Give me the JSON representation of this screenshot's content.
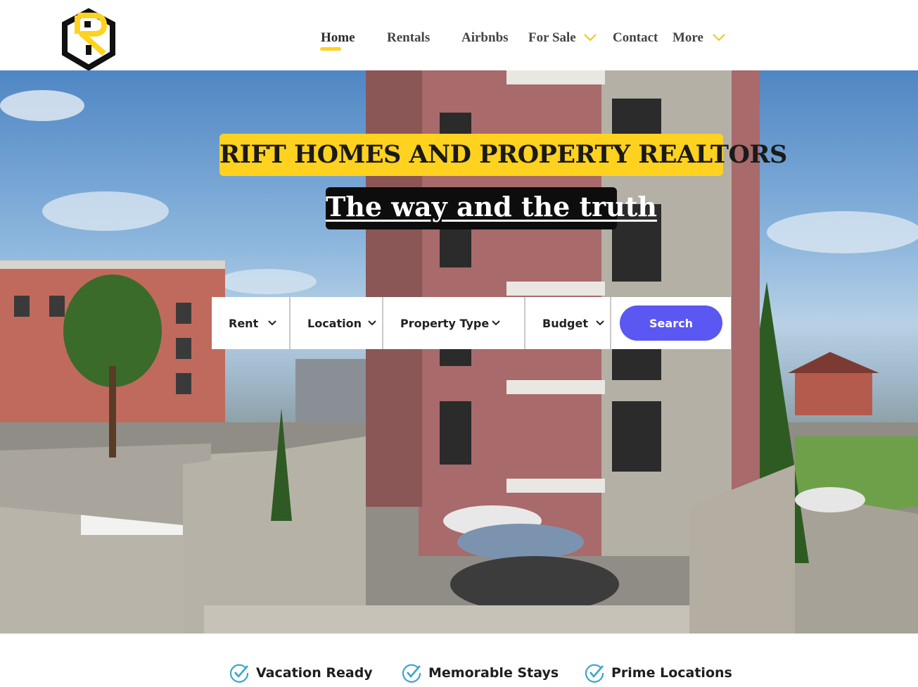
{
  "header": {
    "logo_icon": "rh-house-logo-icon",
    "nav": [
      {
        "label": "Home",
        "active": true
      },
      {
        "label": "Rentals"
      },
      {
        "label": "Airbnbs"
      },
      {
        "label": "For Sale",
        "has_dropdown": true
      },
      {
        "label": "Contact"
      },
      {
        "label": "More",
        "has_dropdown": true
      }
    ],
    "accent_color": "#ffd21f"
  },
  "hero": {
    "title": "RIFT HOMES AND PROPERTY REALTORS",
    "tagline": "The way and the truth",
    "search": {
      "fields": [
        {
          "label": "Rent"
        },
        {
          "label": "Location"
        },
        {
          "label": "Property Type"
        },
        {
          "label": "Budget"
        }
      ],
      "button_label": "Search",
      "button_color": "#5b57f2"
    }
  },
  "features": [
    {
      "label": "Vacation Ready",
      "icon": "check-circle-icon"
    },
    {
      "label": "Memorable Stays",
      "icon": "check-circle-icon"
    },
    {
      "label": "Prime Locations",
      "icon": "check-circle-icon"
    }
  ]
}
